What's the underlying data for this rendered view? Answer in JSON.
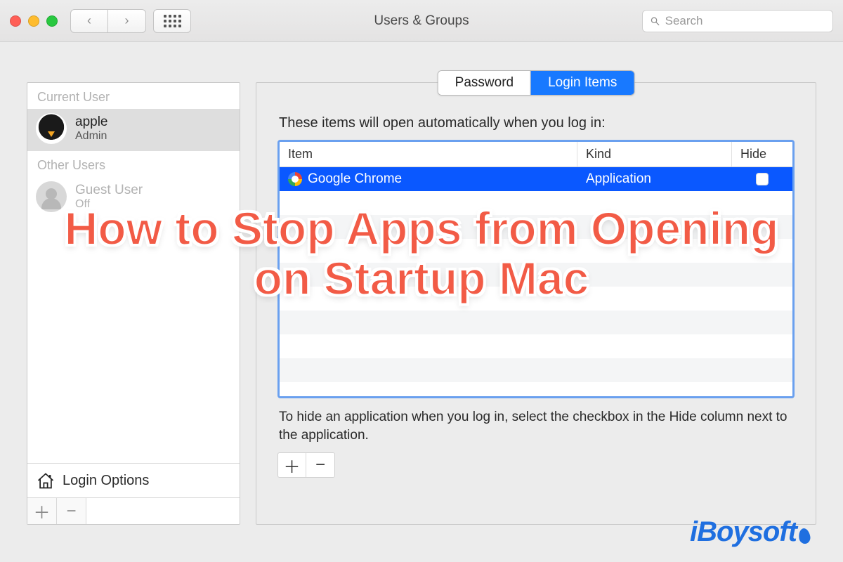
{
  "titlebar": {
    "title": "Users & Groups",
    "search_placeholder": "Search"
  },
  "sidebar": {
    "sections": {
      "current_label": "Current User",
      "other_label": "Other Users"
    },
    "current_user": {
      "name": "apple",
      "role": "Admin"
    },
    "other_users": [
      {
        "name": "Guest User",
        "role": "Off"
      }
    ],
    "login_options_label": "Login Options"
  },
  "tabs": {
    "password": "Password",
    "login_items": "Login Items"
  },
  "main": {
    "intro": "These items will open automatically when you log in:",
    "columns": {
      "item": "Item",
      "kind": "Kind",
      "hide": "Hide"
    },
    "rows": [
      {
        "icon": "chrome",
        "name": "Google Chrome",
        "kind": "Application",
        "hide": false,
        "selected": true
      }
    ],
    "hint": "To hide an application when you log in, select the checkbox in the Hide column next to the application."
  },
  "overlay": {
    "headline": "How to Stop Apps from Opening on Startup Mac",
    "brand": "iBoysoft"
  },
  "glyphs": {
    "plus": "＋",
    "minus": "−",
    "back": "‹",
    "forward": "›"
  }
}
